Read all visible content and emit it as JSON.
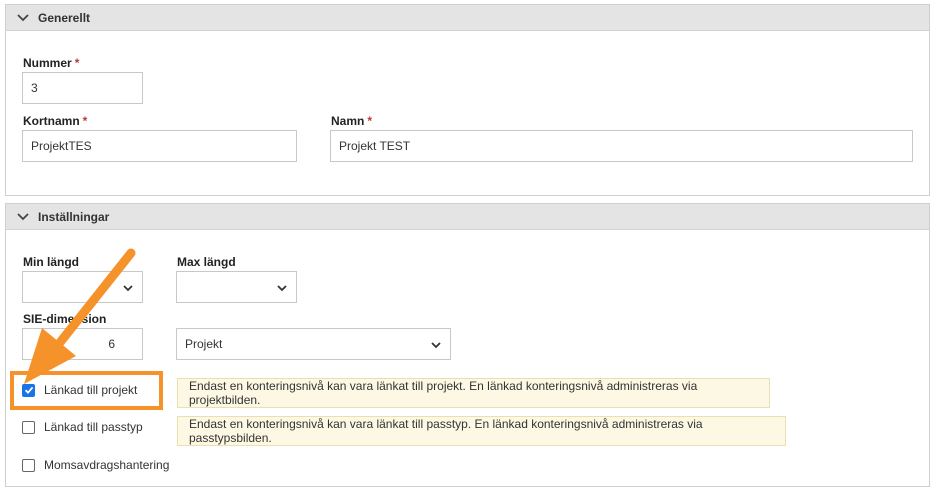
{
  "general": {
    "title": "Generellt",
    "number_label": "Nummer",
    "number_value": "3",
    "shortname_label": "Kortnamn",
    "shortname_value": "ProjektTES",
    "name_label": "Namn",
    "name_value": "Projekt TEST",
    "required_mark": "*"
  },
  "settings": {
    "title": "Inställningar",
    "min_length_label": "Min längd",
    "min_length_value": "",
    "max_length_label": "Max längd",
    "max_length_value": "",
    "sie_label": "SIE-dimension",
    "sie_value": "6",
    "sie_type_value": "Projekt",
    "linked_project_label": "Länkad till projekt",
    "linked_project_checked": true,
    "linked_project_note": "Endast en konteringsnivå kan vara länkat till projekt. En länkad konteringsnivå administreras via projektbilden.",
    "linked_passtyp_label": "Länkad till passtyp",
    "linked_passtyp_checked": false,
    "linked_passtyp_note": "Endast en konteringsnivå kan vara länkat till passtyp. En länkad konteringsnivå administreras via passtypsbilden.",
    "vat_label": "Momsavdragshantering",
    "vat_checked": false
  },
  "colors": {
    "accent": "#1a73e8",
    "annotation": "#f5922a",
    "note_bg": "#fcf8e3",
    "required": "#c0392b"
  }
}
